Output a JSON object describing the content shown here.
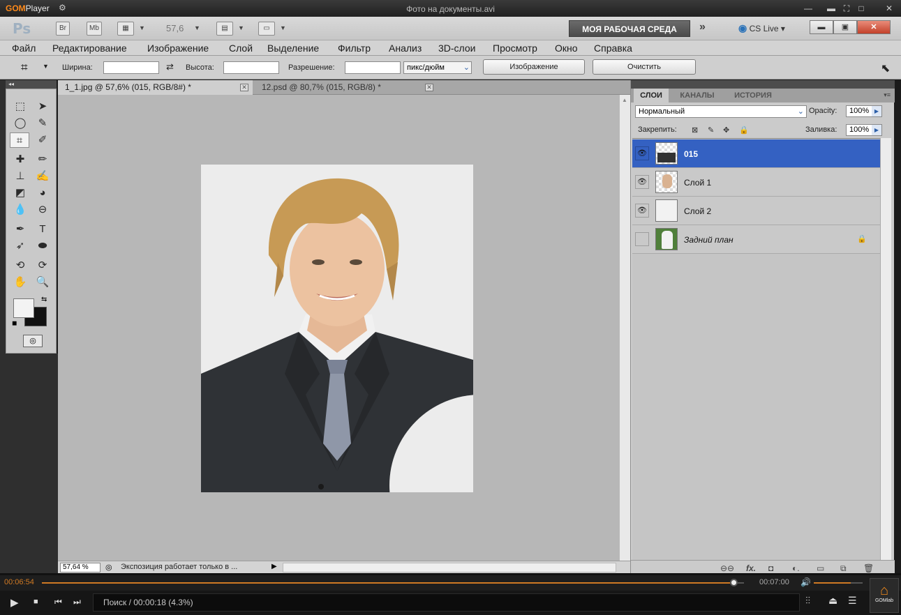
{
  "gom": {
    "logo": "GOM",
    "logo_suffix": "Player",
    "file_title": "Фото на документы.avi",
    "seek_current": "00:06:54",
    "seek_total": "00:07:00",
    "seek_progress": 0.986,
    "volume_level": 0.75,
    "status_text": "Поиск / 00:00:18 (4.3%)",
    "brand_label": "GOMlab",
    "accent_color": "#d07a24"
  },
  "ps": {
    "logo": "Ps",
    "appbar": {
      "br": "Br",
      "mb": "Mb",
      "zoom": "57,6",
      "workspace_button": "МОЯ РАБОЧАЯ СРЕДА",
      "cs_live": "CS Live"
    },
    "menu": [
      "Файл",
      "Редактирование",
      "Изображение",
      "Слой",
      "Выделение",
      "Фильтр",
      "Анализ",
      "3D-слои",
      "Просмотр",
      "Окно",
      "Справка"
    ],
    "options": {
      "width_label": "Ширина:",
      "height_label": "Высота:",
      "resolution_label": "Разрешение:",
      "unit_value": "пикс/дюйм",
      "image_button": "Изображение",
      "clear_button": "Очистить"
    },
    "tabs": [
      {
        "label": "1_1.jpg @ 57,6% (015, RGB/8#) *"
      },
      {
        "label": "12.psd @ 80,7% (015, RGB/8) *"
      }
    ],
    "status": {
      "zoom": "57,64 %",
      "info": "Экспозиция работает только в ..."
    },
    "layers_panel": {
      "tabs": [
        "СЛОИ",
        "КАНАЛЫ",
        "ИСТОРИЯ"
      ],
      "blend_mode": "Нормальный",
      "opacity_label": "Opacity:",
      "opacity_value": "100%",
      "lock_label": "Закрепить:",
      "fill_label": "Заливка:",
      "fill_value": "100%",
      "layers": [
        {
          "name": "015"
        },
        {
          "name": "Слой 1"
        },
        {
          "name": "Слой 2"
        },
        {
          "name": "Задний план"
        }
      ]
    }
  }
}
